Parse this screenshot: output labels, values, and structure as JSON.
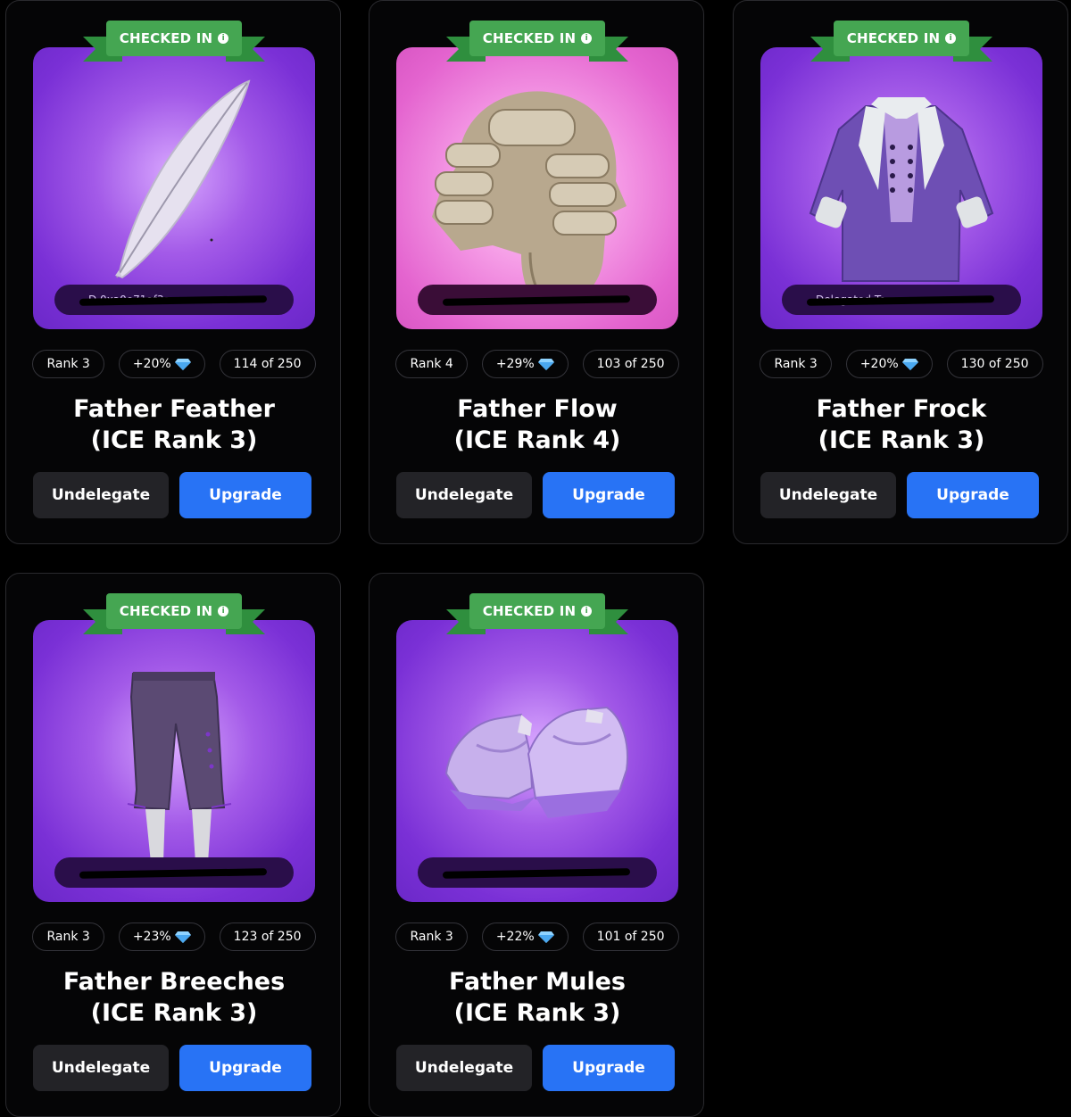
{
  "cards": [
    {
      "badge": "CHECKED IN",
      "badge_info_icon": "info-icon",
      "delegate_text": "D 0xa0e71af3ae...",
      "art_theme": "purple",
      "item_art": "feather",
      "rank": "Rank 3",
      "bonus": "+20%",
      "bonus_icon": "gem-icon",
      "supply": "114 of 250",
      "name_line1": "Father Feather",
      "name_line2": "(ICE Rank 3)",
      "undelegate_label": "Undelegate",
      "upgrade_label": "Upgrade"
    },
    {
      "badge": "CHECKED IN",
      "badge_info_icon": "info-icon",
      "delegate_text": "...",
      "art_theme": "pink",
      "item_art": "wig",
      "rank": "Rank 4",
      "bonus": "+29%",
      "bonus_icon": "gem-icon",
      "supply": "103 of 250",
      "name_line1": "Father Flow",
      "name_line2": "(ICE Rank 4)",
      "undelegate_label": "Undelegate",
      "upgrade_label": "Upgrade"
    },
    {
      "badge": "CHECKED IN",
      "badge_info_icon": "info-icon",
      "delegate_text": "Delegated To ...",
      "art_theme": "purple",
      "item_art": "frock",
      "rank": "Rank 3",
      "bonus": "+20%",
      "bonus_icon": "gem-icon",
      "supply": "130 of 250",
      "name_line1": "Father Frock",
      "name_line2": "(ICE Rank 3)",
      "undelegate_label": "Undelegate",
      "upgrade_label": "Upgrade"
    },
    {
      "badge": "CHECKED IN",
      "badge_info_icon": "info-icon",
      "delegate_text": "...",
      "art_theme": "purple",
      "item_art": "breeches",
      "rank": "Rank 3",
      "bonus": "+23%",
      "bonus_icon": "gem-icon",
      "supply": "123 of 250",
      "name_line1": "Father Breeches",
      "name_line2": "(ICE Rank 3)",
      "undelegate_label": "Undelegate",
      "upgrade_label": "Upgrade"
    },
    {
      "badge": "CHECKED IN",
      "badge_info_icon": "info-icon",
      "delegate_text": "...",
      "art_theme": "purple",
      "item_art": "mules",
      "rank": "Rank 3",
      "bonus": "+22%",
      "bonus_icon": "gem-icon",
      "supply": "101 of 250",
      "name_line1": "Father Mules",
      "name_line2": "(ICE Rank 3)",
      "undelegate_label": "Undelegate",
      "upgrade_label": "Upgrade"
    }
  ],
  "colors": {
    "page_bg": "#000000",
    "badge_green": "#45a652",
    "upgrade_blue": "#2873f5",
    "undelegate_gray": "#232327",
    "art_purple": "#8c3fe0",
    "art_pink": "#e87bd8"
  }
}
